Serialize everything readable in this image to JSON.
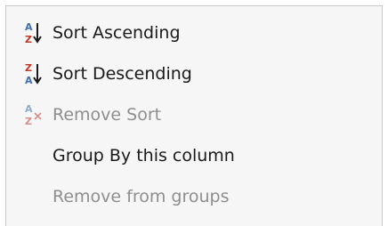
{
  "menu": {
    "items": [
      {
        "label": "Sort Ascending",
        "icon": "sort-ascending-icon",
        "enabled": true
      },
      {
        "label": "Sort Descending",
        "icon": "sort-descending-icon",
        "enabled": true
      },
      {
        "label": "Remove Sort",
        "icon": "remove-sort-icon",
        "enabled": false
      },
      {
        "label": "Group By this column",
        "icon": "",
        "enabled": true
      },
      {
        "label": "Remove from groups",
        "icon": "",
        "enabled": false
      }
    ]
  },
  "colors": {
    "sort_letter_a": "#3d6fb5",
    "sort_letter_z": "#c0392b",
    "enabled_text": "#1a1a1a",
    "disabled_text": "#8e8e8e",
    "menu_background": "#f6f6f6"
  }
}
